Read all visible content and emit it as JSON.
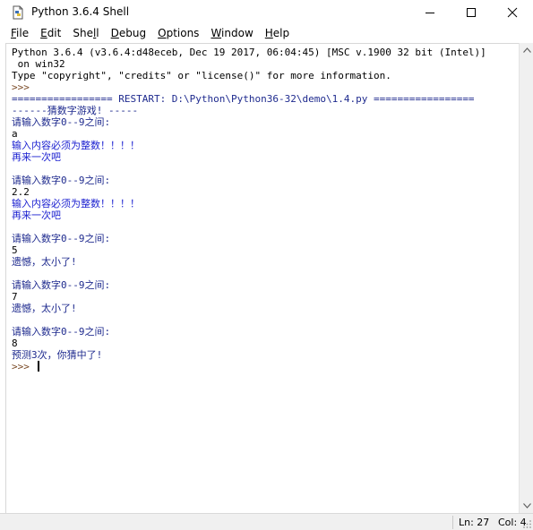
{
  "window": {
    "title": "Python 3.6.4 Shell",
    "icon": "python-file-icon"
  },
  "menu": [
    {
      "key": "F",
      "rest": "ile",
      "pre": ""
    },
    {
      "key": "E",
      "rest": "dit",
      "pre": ""
    },
    {
      "key": "l",
      "rest": "l",
      "pre": "She"
    },
    {
      "key": "D",
      "rest": "ebug",
      "pre": ""
    },
    {
      "key": "O",
      "rest": "ptions",
      "pre": ""
    },
    {
      "key": "W",
      "rest": "indow",
      "pre": ""
    },
    {
      "key": "H",
      "rest": "elp",
      "pre": ""
    }
  ],
  "shell": {
    "lines": [
      {
        "text": "Python 3.6.4 (v3.6.4:d48eceb, Dec 19 2017, 06:04:45) [MSC v.1900 32 bit (Intel)]",
        "kind": "std"
      },
      {
        "text": " on win32",
        "kind": "std"
      },
      {
        "text": "Type \"copyright\", \"credits\" or \"license()\" for more information.",
        "kind": "std"
      },
      {
        "text": ">>> ",
        "kind": "prompt"
      },
      {
        "text": "================= RESTART: D:\\Python\\Python36-32\\demo\\1.4.py =================",
        "kind": "out"
      },
      {
        "text": "------猜数字游戏! -----",
        "kind": "out"
      },
      {
        "text": "请输入数字0--9之间:",
        "kind": "out"
      },
      {
        "text": "a",
        "kind": "user"
      },
      {
        "text": "输入内容必须为整数！！！！",
        "kind": "err"
      },
      {
        "text": "再来一次吧",
        "kind": "err"
      },
      {
        "text": "",
        "kind": "out"
      },
      {
        "text": "请输入数字0--9之间:",
        "kind": "out"
      },
      {
        "text": "2.2",
        "kind": "user"
      },
      {
        "text": "输入内容必须为整数！！！！",
        "kind": "err"
      },
      {
        "text": "再来一次吧",
        "kind": "err"
      },
      {
        "text": "",
        "kind": "out"
      },
      {
        "text": "请输入数字0--9之间:",
        "kind": "out"
      },
      {
        "text": "5",
        "kind": "user"
      },
      {
        "text": "遗憾，太小了!",
        "kind": "out"
      },
      {
        "text": "",
        "kind": "out"
      },
      {
        "text": "请输入数字0--9之间:",
        "kind": "out"
      },
      {
        "text": "7",
        "kind": "user"
      },
      {
        "text": "遗憾，太小了!",
        "kind": "out"
      },
      {
        "text": "",
        "kind": "out"
      },
      {
        "text": "请输入数字0--9之间:",
        "kind": "out"
      },
      {
        "text": "8",
        "kind": "user"
      },
      {
        "text": "预测3次，你猜中了!",
        "kind": "out"
      },
      {
        "text": ">>> ",
        "kind": "prompt",
        "cursor": true
      }
    ]
  },
  "status": {
    "line": "Ln: 27",
    "col": "Col: 4"
  },
  "colors": {
    "output": "#1e2a8e",
    "error": "#1a1fd0",
    "prompt": "#7a4a26",
    "text": "#000000"
  }
}
